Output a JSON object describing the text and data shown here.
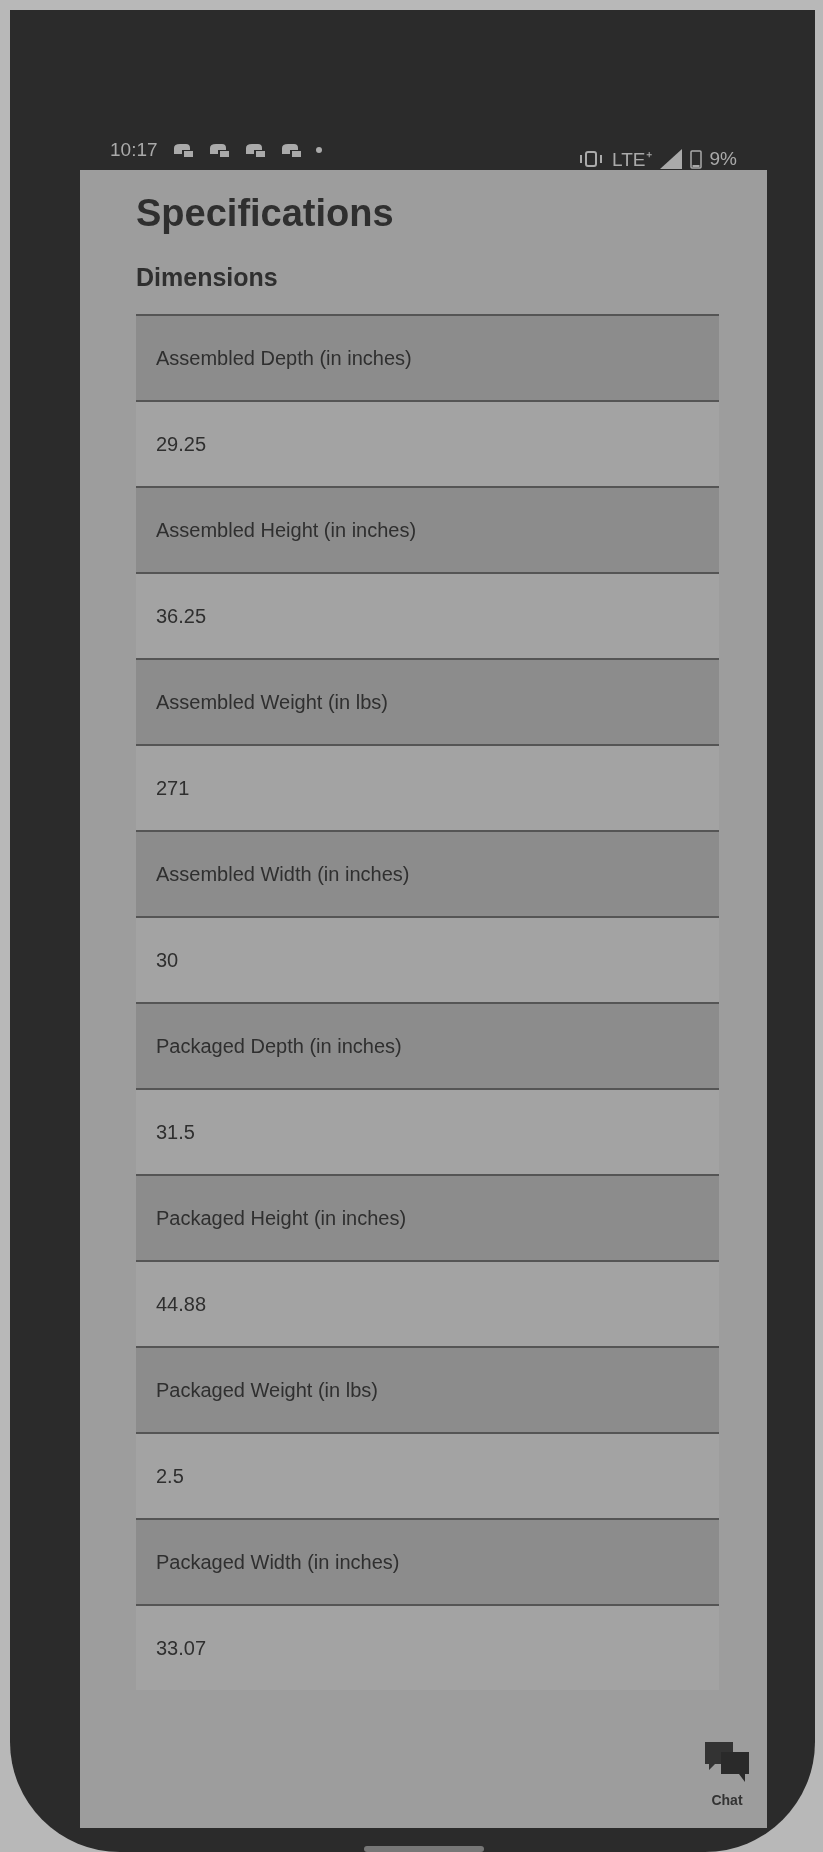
{
  "status_bar": {
    "time": "10:17",
    "network": "LTE⁺",
    "battery": "9%"
  },
  "title": "Specifications",
  "section": {
    "title": "Dimensions",
    "specs": [
      {
        "label": "Assembled Depth (in inches)",
        "value": "29.25"
      },
      {
        "label": "Assembled Height (in inches)",
        "value": "36.25"
      },
      {
        "label": "Assembled Weight (in lbs)",
        "value": "271"
      },
      {
        "label": "Assembled Width (in inches)",
        "value": "30"
      },
      {
        "label": "Packaged Depth (in inches)",
        "value": "31.5"
      },
      {
        "label": "Packaged Height (in inches)",
        "value": "44.88"
      },
      {
        "label": "Packaged Weight (in lbs)",
        "value": "2.5"
      },
      {
        "label": "Packaged Width (in inches)",
        "value": "33.07"
      }
    ]
  },
  "chat_button": {
    "label": "Chat"
  }
}
